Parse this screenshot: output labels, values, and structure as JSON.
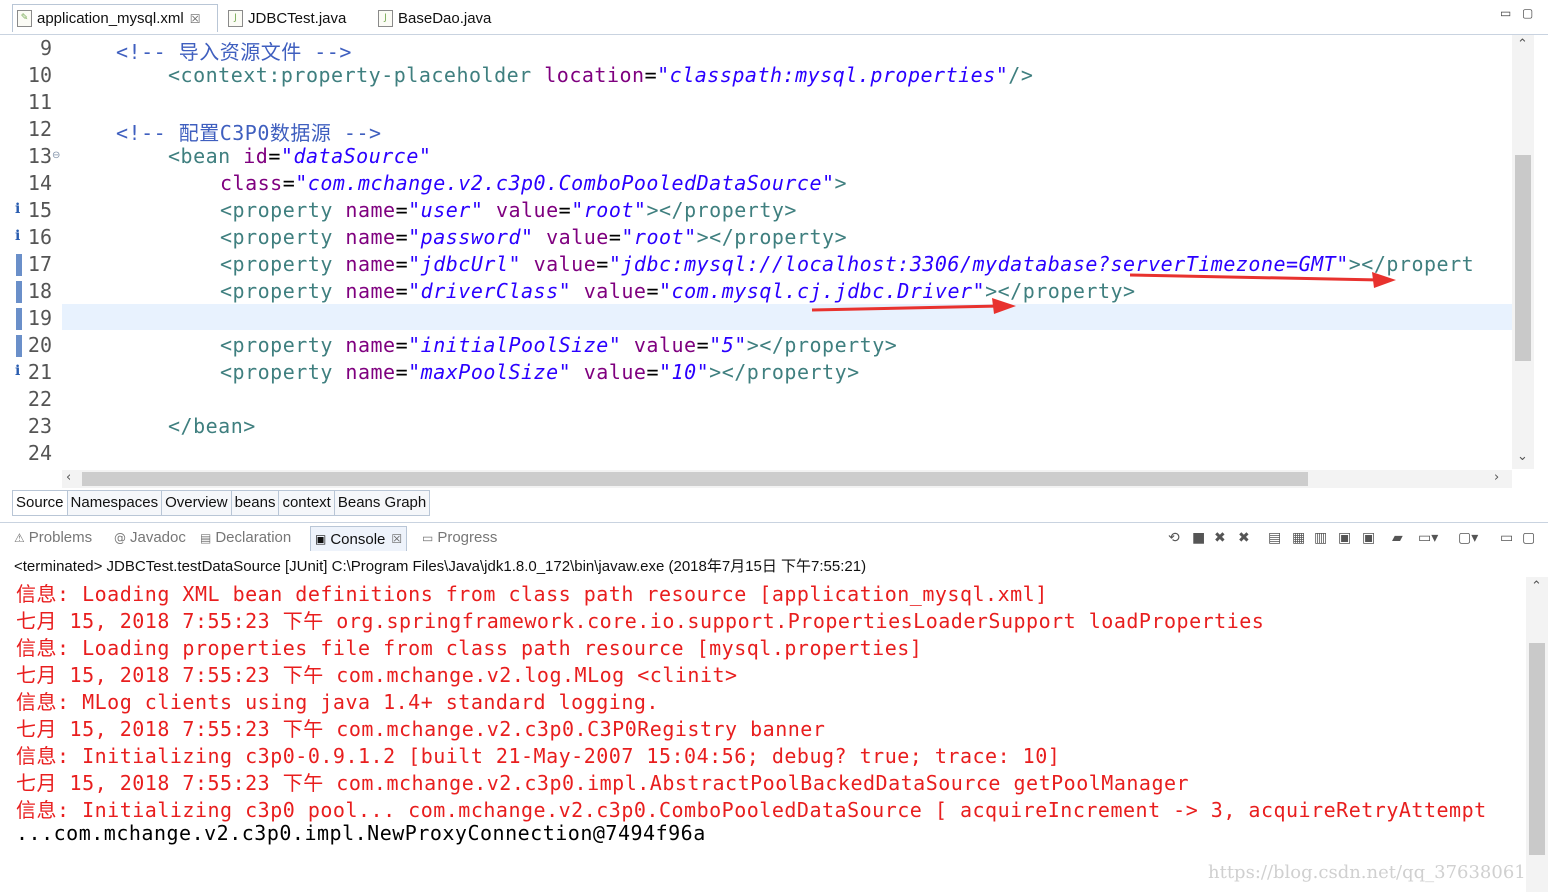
{
  "editor_tabs": [
    {
      "label": "application_mysql.xml",
      "close": "☒"
    },
    {
      "label": "JDBCTest.java"
    },
    {
      "label": "BaseDao.java"
    }
  ],
  "window_controls": {
    "minimize": "▭",
    "maximize": "▢"
  },
  "editor": {
    "line_numbers": [
      "9",
      "10",
      "11",
      "12",
      "13",
      "14",
      "15",
      "16",
      "17",
      "18",
      "19",
      "20",
      "21",
      "22",
      "23",
      "24"
    ],
    "comment1": "<!-- 导入资源文件 -->",
    "context_tag": "<context:property-placeholder",
    "context_attr": "location",
    "context_val": "\"classpath:mysql.properties\"",
    "context_end": "/>",
    "comment2": "<!-- 配置C3P0数据源 -->",
    "bean_open": "<bean",
    "bean_id_attr": "id",
    "bean_id_val": "\"dataSource\"",
    "class_attr": "class",
    "class_val": "\"com.mchange.v2.c3p0.ComboPooledDataSource\"",
    "class_end": ">",
    "prop_open": "<property",
    "name_attr": "name",
    "value_attr": "value",
    "prop_close": "></property>",
    "prop_close_cut": "></propert",
    "properties": [
      {
        "name": "\"user\"",
        "value": "\"root\""
      },
      {
        "name": "\"password\"",
        "value": "\"root\""
      },
      {
        "name": "\"jdbcUrl\"",
        "value": "\"jdbc:mysql://localhost:3306/mydatabase?serverTimezone=GMT\""
      },
      {
        "name": "\"driverClass\"",
        "value": "\"com.mysql.cj.jdbc.Driver\""
      },
      {
        "name": "\"initialPoolSize\"",
        "value": "\"5\""
      },
      {
        "name": "\"maxPoolSize\"",
        "value": "\"10\""
      }
    ],
    "bean_close": "</bean>"
  },
  "source_tabs": [
    "Source",
    "Namespaces",
    "Overview",
    "beans",
    "context",
    "Beans Graph"
  ],
  "view_tabs": [
    {
      "label": "Problems",
      "icon": "⚠"
    },
    {
      "label": "Javadoc",
      "icon": "@"
    },
    {
      "label": "Declaration",
      "icon": "▤"
    },
    {
      "label": "Console",
      "icon": "▣",
      "close": "☒"
    },
    {
      "label": "Progress",
      "icon": "▭"
    }
  ],
  "console_status": "<terminated> JDBCTest.testDataSource [JUnit] C:\\Program Files\\Java\\jdk1.8.0_172\\bin\\javaw.exe (2018年7月15日 下午7:55:21)",
  "console_lines": [
    "信息: Loading XML bean definitions from class path resource [application_mysql.xml]",
    "七月 15, 2018 7:55:23 下午 org.springframework.core.io.support.PropertiesLoaderSupport loadProperties",
    "信息: Loading properties file from class path resource [mysql.properties]",
    "七月 15, 2018 7:55:23 下午 com.mchange.v2.log.MLog <clinit>",
    "信息: MLog clients using java 1.4+ standard logging.",
    "七月 15, 2018 7:55:23 下午 com.mchange.v2.c3p0.C3P0Registry banner",
    "信息: Initializing c3p0-0.9.1.2 [built 21-May-2007 15:04:56; debug? true; trace: 10]",
    "七月 15, 2018 7:55:23 下午 com.mchange.v2.c3p0.impl.AbstractPoolBackedDataSource getPoolManager",
    "信息: Initializing c3p0 pool... com.mchange.v2.c3p0.ComboPooledDataSource [ acquireIncrement -> 3, acquireRetryAttempt",
    "...com.mchange.v2.c3p0.impl.NewProxyConnection@7494f96a"
  ],
  "watermark": "https://blog.csdn.net/qq_37638061",
  "colors": {
    "console_error": "#e81e1e",
    "xml_tag": "#3f7f7f",
    "xml_attr": "#7f007f",
    "xml_value": "#2a00ff",
    "annotation_arrow": "#e8322e"
  }
}
